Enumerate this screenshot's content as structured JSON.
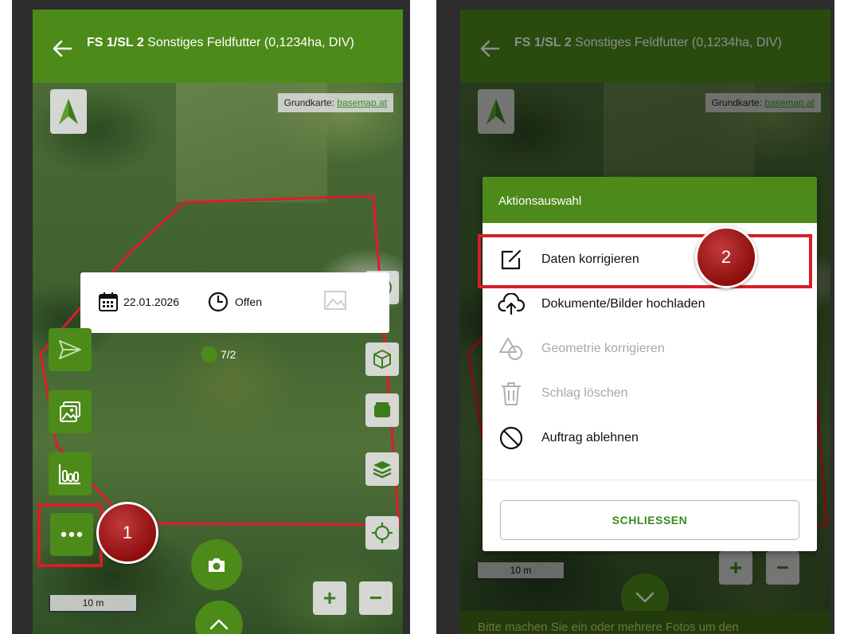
{
  "header": {
    "title_bold": "FS 1/SL 2",
    "title_rest": " Sonstiges Feldfutter (0,1234ha, DIV)"
  },
  "attribution": {
    "label": "Grundkarte: ",
    "link": "basemap.at"
  },
  "info_card": {
    "date": "22.01.2026",
    "status": "Offen"
  },
  "counter": "7/2",
  "scale": "10 m",
  "markers": {
    "step1": "1",
    "step2": "2"
  },
  "dialog": {
    "title": "Aktionsauswahl",
    "items": [
      {
        "label": "Daten korrigieren",
        "icon": "edit-icon",
        "enabled": true
      },
      {
        "label": "Dokumente/Bilder hochladen",
        "icon": "cloud-upload-icon",
        "enabled": true
      },
      {
        "label": "Geometrie korrigieren",
        "icon": "shapes-icon",
        "enabled": false
      },
      {
        "label": "Schlag löschen",
        "icon": "trash-icon",
        "enabled": false
      },
      {
        "label": "Auftrag ablehnen",
        "icon": "block-icon",
        "enabled": true
      }
    ],
    "close_label": "SCHLIESSEN"
  },
  "bottom_banner": "Bitte machen Sie ein oder mehrere Fotos um den",
  "zoom": {
    "plus": "+",
    "minus": "−"
  },
  "colors": {
    "primary_green": "#4c8a1a",
    "polygon_red": "#e01b2c",
    "marker_red": "#a31a1a",
    "highlight_red": "#d61f26"
  }
}
